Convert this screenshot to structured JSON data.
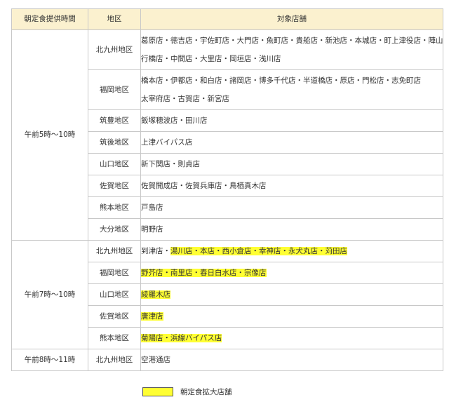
{
  "table": {
    "headers": [
      "朝定食提供時間",
      "地区",
      "対象店舗"
    ],
    "groups": [
      {
        "time": "午前5時～10時",
        "rows": [
          {
            "area": "北九州地区",
            "lines": [
              [
                {
                  "t": "葛原店・徳吉店・宇佐町店・大門店・魚町店・貴船店・新池店・本城店・町上津役店・陣山店",
                  "hl": false
                }
              ],
              [
                {
                  "t": "行橋店・中間店・大里店・岡垣店・浅川店",
                  "hl": false
                }
              ]
            ]
          },
          {
            "area": "福岡地区",
            "lines": [
              [
                {
                  "t": "橋本店・伊都店・和白店・諸岡店・博多千代店・半道橋店・原店・門松店・志免町店",
                  "hl": false
                }
              ],
              [
                {
                  "t": "太宰府店・古賀店・新宮店",
                  "hl": false
                }
              ]
            ]
          },
          {
            "area": "筑豊地区",
            "lines": [
              [
                {
                  "t": "飯塚穂波店・田川店",
                  "hl": false
                }
              ]
            ]
          },
          {
            "area": "筑後地区",
            "lines": [
              [
                {
                  "t": "上津バイパス店",
                  "hl": false
                }
              ]
            ]
          },
          {
            "area": "山口地区",
            "lines": [
              [
                {
                  "t": "新下関店・則貞店",
                  "hl": false
                }
              ]
            ]
          },
          {
            "area": "佐賀地区",
            "lines": [
              [
                {
                  "t": "佐賀開成店・佐賀兵庫店・鳥栖真木店",
                  "hl": false
                }
              ]
            ]
          },
          {
            "area": "熊本地区",
            "lines": [
              [
                {
                  "t": "戸島店",
                  "hl": false
                }
              ]
            ]
          },
          {
            "area": "大分地区",
            "lines": [
              [
                {
                  "t": "明野店",
                  "hl": false
                }
              ]
            ]
          }
        ]
      },
      {
        "time": "午前7時～10時",
        "rows": [
          {
            "area": "北九州地区",
            "lines": [
              [
                {
                  "t": "到津店・",
                  "hl": false
                },
                {
                  "t": "湯川店・本店・西小倉店・幸神店・永犬丸店・苅田店",
                  "hl": true
                }
              ]
            ]
          },
          {
            "area": "福岡地区",
            "lines": [
              [
                {
                  "t": "野芥店・南里店・春日白水店・宗像店",
                  "hl": true
                }
              ]
            ]
          },
          {
            "area": "山口地区",
            "lines": [
              [
                {
                  "t": "綾羅木店",
                  "hl": true
                }
              ]
            ]
          },
          {
            "area": "佐賀地区",
            "lines": [
              [
                {
                  "t": "唐津店",
                  "hl": true
                }
              ]
            ]
          },
          {
            "area": "熊本地区",
            "lines": [
              [
                {
                  "t": "菊陽店・浜線バイパス店",
                  "hl": true
                }
              ]
            ]
          }
        ]
      },
      {
        "time": "午前8時～11時",
        "rows": [
          {
            "area": "北九州地区",
            "lines": [
              [
                {
                  "t": "空港通店",
                  "hl": false
                }
              ]
            ]
          }
        ]
      }
    ]
  },
  "legend": {
    "label": "朝定食拡大店舗",
    "color": "#ffff33"
  }
}
